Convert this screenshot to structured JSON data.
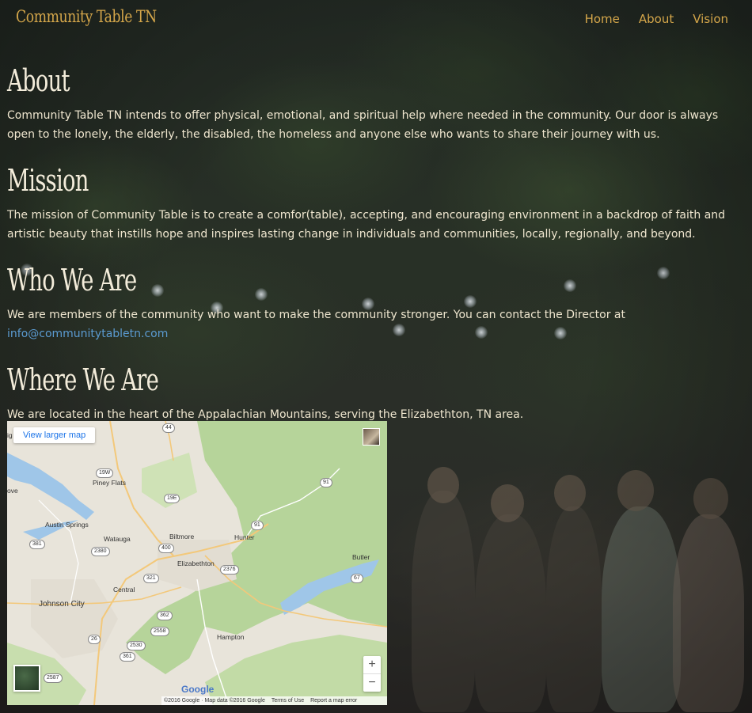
{
  "nav": {
    "brand": "Community Table TN",
    "links": [
      "Home",
      "About",
      "Vision"
    ]
  },
  "sections": [
    {
      "title": "About",
      "text": "Community Table TN intends to offer physical, emotional, and spiritual help where needed in the community. Our door is always open to the lonely, the elderly, the disabled, the homeless and anyone else who wants to share their journey with us."
    },
    {
      "title": "Mission",
      "text": "The mission of Community Table is to create a comfor(table), accepting, and encouraging environment in a backdrop of faith and artistic beauty that instills hope and inspires lasting change in individuals and communities, locally, regionally, and beyond."
    },
    {
      "title": "Who We Are",
      "text": "We are members of the community who want to make the community stronger. You can contact the Director at ",
      "email": "info@communitytabletn.com"
    },
    {
      "title": "Where We Are",
      "text": "We are located in the heart of the Appalachian Mountains, serving the Elizabethton, TN area."
    }
  ],
  "map": {
    "view_larger": "View larger map",
    "zoom_in": "+",
    "zoom_out": "−",
    "google": "Google",
    "attribution": [
      "©2016 Google · Map data ©2016 Google",
      "Terms of Use",
      "Report a map error"
    ],
    "places": [
      "Piney Flats",
      "Austin Springs",
      "Watauga",
      "Biltmore",
      "Hunter",
      "Elizabethton",
      "Central",
      "Johnson City",
      "Hampton",
      "Butler"
    ],
    "routes": [
      "44",
      "19W",
      "91",
      "19E",
      "381",
      "2380",
      "400",
      "2376",
      "67",
      "321",
      "362",
      "2558",
      "26",
      "2530",
      "361",
      "2587",
      "91"
    ],
    "edge_labels": [
      "ig",
      "ove"
    ]
  }
}
